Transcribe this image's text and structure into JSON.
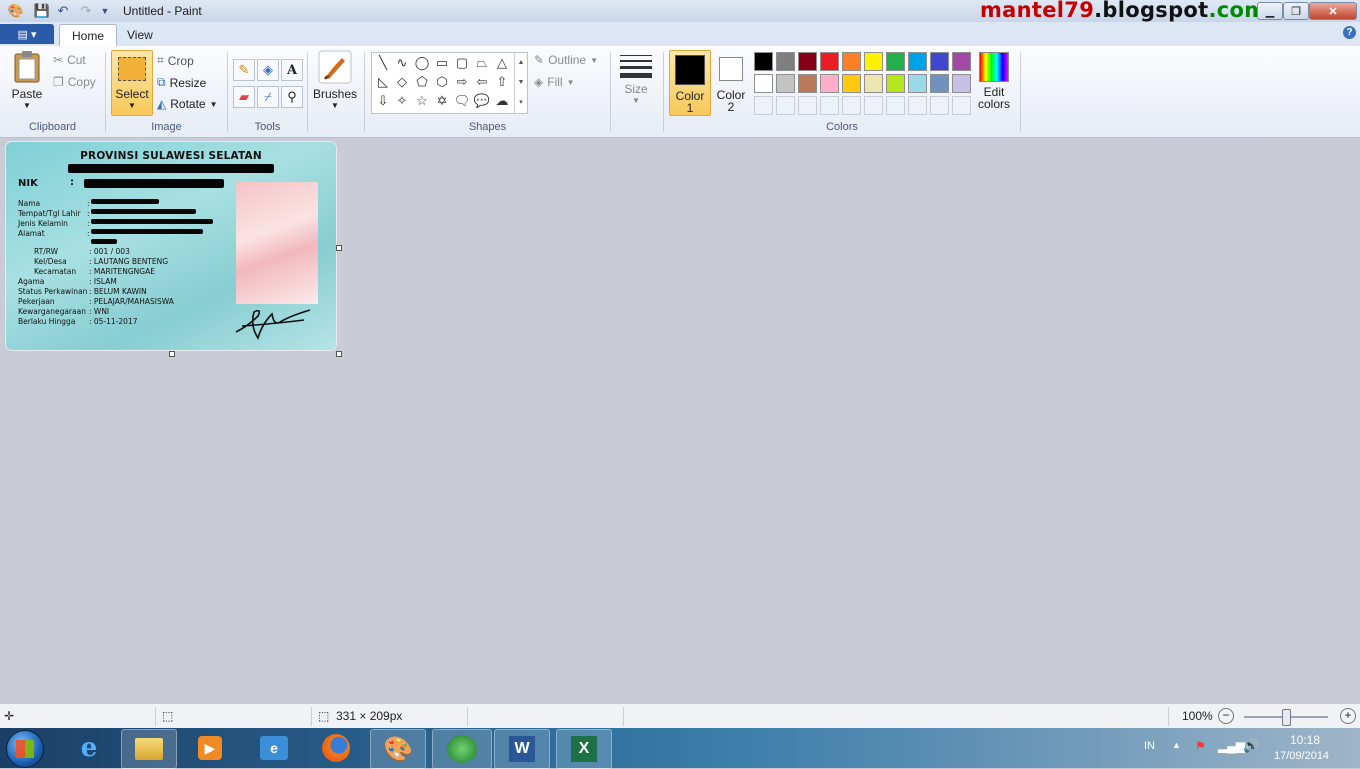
{
  "window": {
    "title": "Untitled - Paint",
    "watermark_red": "mantel79",
    "watermark_mid": ".blogspot",
    "watermark_green": ".com",
    "minimize": "▁",
    "maximize": "❐",
    "close": "✕"
  },
  "tabs": {
    "menu_icon": "▤ ▾",
    "home": "Home",
    "view": "View",
    "help": "?"
  },
  "ribbon": {
    "clipboard": {
      "label": "Clipboard",
      "paste": "Paste",
      "cut": "Cut",
      "copy": "Copy"
    },
    "image": {
      "label": "Image",
      "select": "Select",
      "crop": "Crop",
      "resize": "Resize",
      "rotate": "Rotate"
    },
    "tools": {
      "label": "Tools"
    },
    "brushes": {
      "label": "Brushes"
    },
    "shapes": {
      "label": "Shapes",
      "outline": "Outline",
      "fill": "Fill"
    },
    "size": {
      "label": "Size"
    },
    "color1": {
      "line1": "Color",
      "line2": "1",
      "value": "#000000"
    },
    "color2": {
      "line1": "Color",
      "line2": "2",
      "value": "#ffffff"
    },
    "colors": {
      "label": "Colors",
      "edit_line1": "Edit",
      "edit_line2": "colors",
      "row1": [
        "#000000",
        "#7f7f7f",
        "#880015",
        "#ed1c24",
        "#ff7f27",
        "#fff200",
        "#22b14c",
        "#00a2e8",
        "#3f48cc",
        "#a349a4"
      ],
      "row2": [
        "#ffffff",
        "#c3c3c3",
        "#b97a57",
        "#ffaec9",
        "#ffc90e",
        "#efe4b0",
        "#b5e61d",
        "#99d9ea",
        "#7092be",
        "#c8bfe7"
      ]
    }
  },
  "card": {
    "title": "PROVINSI SULAWESI SELATAN",
    "nik_label": "NIK",
    "colon": ":",
    "labels": [
      "Nama",
      "Tempat/Tgl Lahir",
      "Jenis Kelamin",
      "Alamat",
      "RT/RW",
      "Kel/Desa",
      "Kecamatan",
      "Agama",
      "Status Perkawinan",
      "Pekerjaan",
      "Kewarganegaraan",
      "Berlaku Hingga"
    ],
    "values": {
      "rtrw": ": 001 / 003",
      "keldesa": ": LAUTANG BENTENG",
      "kecamatan": ": MARITENGNGAE",
      "agama": ": ISLAM",
      "status": ": BELUM KAWIN",
      "pekerjaan": ": PELAJAR/MAHASISWA",
      "kewarganegaraan": ": WNI",
      "berlaku": ": 05-11-2017"
    }
  },
  "status": {
    "dimensions": "331 × 209px",
    "zoom": "100%"
  },
  "taskbar": {
    "lang": "IN",
    "time": "10:18",
    "date": "17/09/2014"
  }
}
